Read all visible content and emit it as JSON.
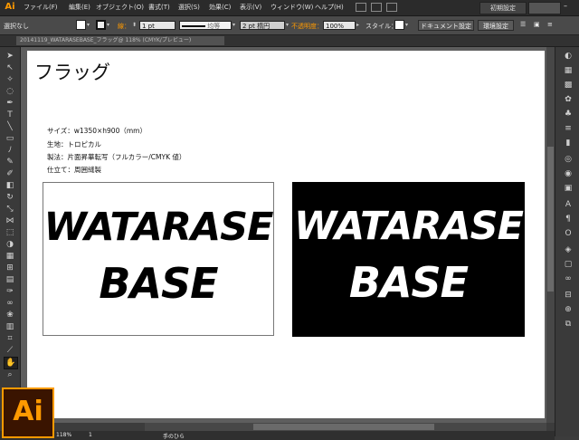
{
  "app": {
    "logo_small": "Ai",
    "logo_large": "Ai"
  },
  "menu": {
    "items": [
      "ファイル(F)",
      "編集(E)",
      "オブジェクト(O)",
      "書式(T)",
      "選択(S)",
      "効果(C)",
      "表示(V)",
      "ウィンドウ(W)",
      "ヘルプ(H)"
    ],
    "workspace": "初期設定"
  },
  "control": {
    "selection": "選択なし",
    "stroke_label": "線：",
    "stroke_weight": "1 pt",
    "profile": "均等",
    "brush": "2 pt 楕円",
    "opacity_label": "不透明度：",
    "opacity_value": "100%",
    "style_label": "スタイル：",
    "doc_settings": "ドキュメント設定",
    "prefs": "環境設定",
    "accent": "#ff9a00"
  },
  "document": {
    "tab_title": "20141119_WATARASEBASE_フラッグ@ 118% (CMYK/プレビュー)"
  },
  "artwork": {
    "title": "フラッグ",
    "specs": [
      "サイズ：w1350×h900（mm）",
      "生地：トロピカル",
      "製法：片面昇華転写（フルカラー/CMYK 値）",
      "仕立て：周囲縫製"
    ],
    "flag_line1": "WATARASE",
    "flag_line2": "BASE"
  },
  "status": {
    "zoom": "118%",
    "page": "1",
    "tool": "手のひら"
  }
}
